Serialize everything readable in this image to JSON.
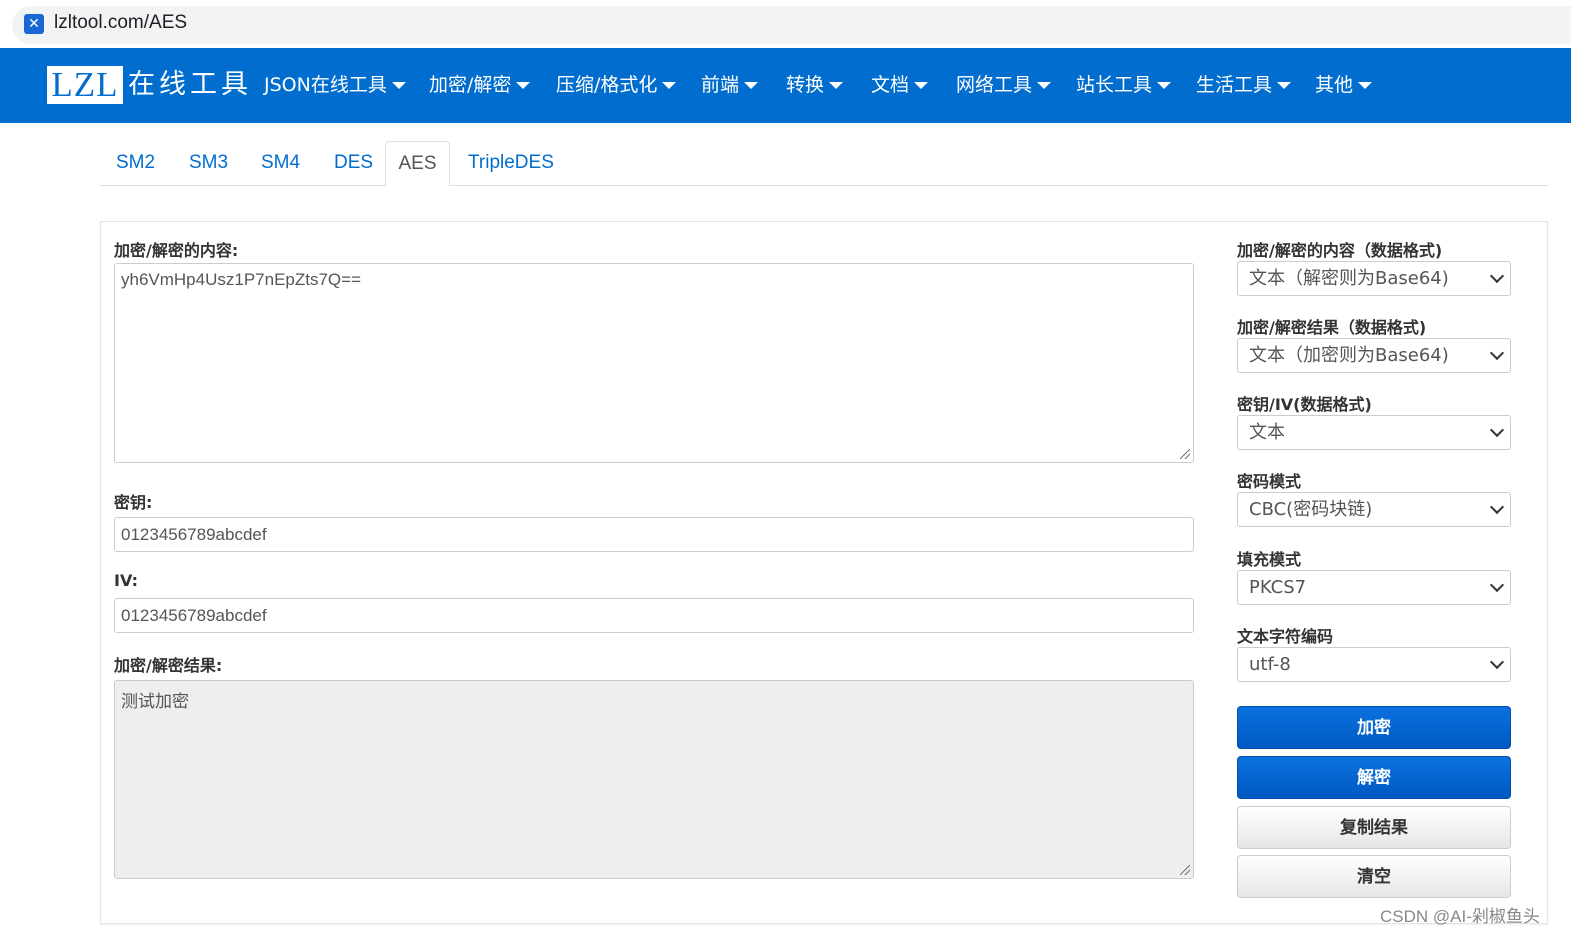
{
  "browser": {
    "url": "lzltool.com/AES"
  },
  "nav": {
    "logo_mark": "LZL",
    "logo_text": "在线工具",
    "items": [
      {
        "label": "JSON在线工具"
      },
      {
        "label": "加密/解密"
      },
      {
        "label": "压缩/格式化"
      },
      {
        "label": "前端"
      },
      {
        "label": "转换"
      },
      {
        "label": "文档"
      },
      {
        "label": "网络工具"
      },
      {
        "label": "站长工具"
      },
      {
        "label": "生活工具"
      },
      {
        "label": "其他"
      }
    ]
  },
  "tabs": [
    {
      "label": "SM2"
    },
    {
      "label": "SM3"
    },
    {
      "label": "SM4"
    },
    {
      "label": "DES"
    },
    {
      "label": "AES",
      "active": true
    },
    {
      "label": "TripleDES"
    }
  ],
  "form": {
    "content_label": "加密/解密的内容:",
    "content_value": "yh6VmHp4Usz1P7nEpZts7Q==",
    "key_label": "密钥:",
    "key_value": "0123456789abcdef",
    "iv_label": "IV:",
    "iv_value": "0123456789abcdef",
    "result_label": "加密/解密结果:",
    "result_value": "测试加密"
  },
  "options": {
    "input_format_label": "加密/解密的内容（数据格式)",
    "input_format_value": "文本（解密则为Base64)",
    "output_format_label": "加密/解密结果（数据格式)",
    "output_format_value": "文本（加密则为Base64)",
    "key_format_label": "密钥/IV(数据格式)",
    "key_format_value": "文本",
    "mode_label": "密码模式",
    "mode_value": "CBC(密码块链)",
    "padding_label": "填充模式",
    "padding_value": "PKCS7",
    "charset_label": "文本字符编码",
    "charset_value": "utf-8"
  },
  "buttons": {
    "encrypt": "加密",
    "decrypt": "解密",
    "copy": "复制结果",
    "clear": "清空"
  },
  "watermark": "CSDN @AI-剁椒鱼头",
  "colors": {
    "brand": "#006dcf",
    "primary_button": "#0a67d8"
  }
}
